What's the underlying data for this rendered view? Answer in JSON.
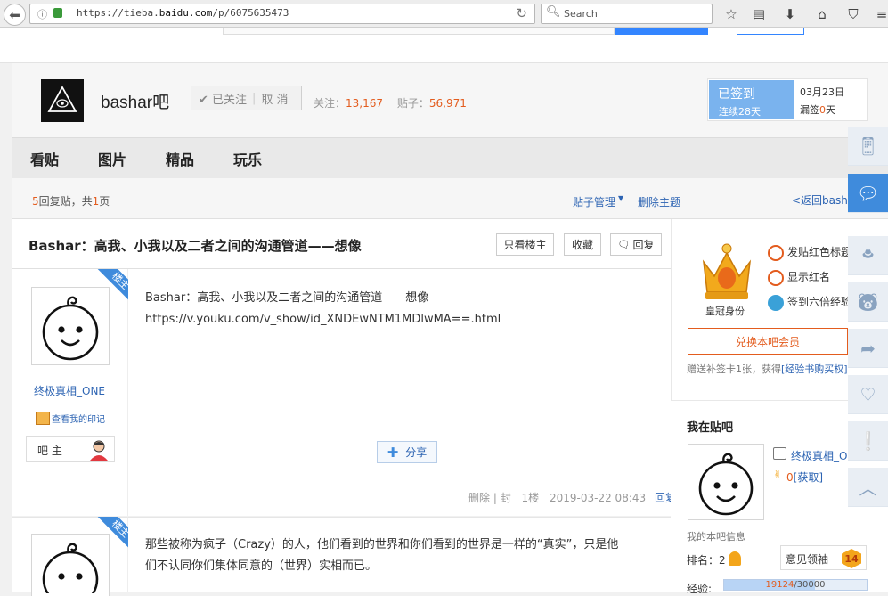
{
  "browser": {
    "url_prefix": "https://tieba.",
    "url_domain": "baidu.com",
    "url_path": "/p/6075635473",
    "search_placeholder": "Search"
  },
  "forum": {
    "name": "bashar吧",
    "follow_label": "✔ 已关注",
    "unfollow_label": "取 消",
    "follow_count_label": "关注：",
    "follow_count": "13,167",
    "post_count_label": "贴子：",
    "post_count": "56,971",
    "signed_label": "已签到",
    "streak_prefix": "连续",
    "streak_days": "28",
    "streak_suffix": "天",
    "date": "03月23日",
    "missed_prefix": "漏签",
    "missed_days": "0",
    "missed_suffix": "天"
  },
  "nav": {
    "tabs": [
      "看贴",
      "图片",
      "精品",
      "玩乐"
    ]
  },
  "reply_bar": {
    "count": "5",
    "count_text": "回复贴，共",
    "pages": "1",
    "pages_text": "页",
    "manage": "贴子管理",
    "delete_topic": "删除主题",
    "back": "<返回bash"
  },
  "thread": {
    "title": "Bashar：高我、小我以及二者之间的沟通管道——想像",
    "only_op": "只看楼主",
    "favorite": "收藏",
    "reply": "回复"
  },
  "post1": {
    "badge": "楼主",
    "user": "终极真相_ONE",
    "imprint": "查看我的印记",
    "role": "吧 主",
    "text": "Bashar：高我、小我以及二者之间的沟通管道——想像",
    "link": "https://v.youku.com/v_show/id_XNDEwNTM1MDlwMA==.html",
    "share": "分享",
    "meta_delete": "删除",
    "meta_ban": "封",
    "floor": "1楼",
    "time": "2019-03-22 08:43",
    "reply": "回复"
  },
  "post2": {
    "badge": "楼主",
    "text_line1": "那些被称为疯子（Crazy）的人，他们看到的世界和你们看到的世界是一样的“真实”，只是他",
    "text_line2": "们不认同你们集体同意的（世界）实相而已。"
  },
  "membership": {
    "crown_label": "皇冠身份",
    "perk1": "发贴红色标题",
    "perk2": "显示红名",
    "perk3": "签到六倍经验",
    "buy_button": "兑换本吧会员",
    "gift_text": "赠送补签卡1张，获得",
    "gift_link": "[经验书购买权]"
  },
  "my_forum": {
    "title": "我在贴吧",
    "user": "终极真相_O",
    "coins": "0",
    "coins_link": "[获取]",
    "info_label": "我的本吧信息",
    "rank_label": "排名：",
    "rank": "2",
    "feedback": "意见领袖",
    "level": "14",
    "exp_label": "经验:",
    "exp_value": "19124",
    "exp_max": "/30000",
    "exp_fraction": 0.637
  },
  "colors": {
    "accent": "#2d64b3",
    "orange": "#e35c1e",
    "signed": "#7ab3ee",
    "badge": "#3f8bdc"
  }
}
